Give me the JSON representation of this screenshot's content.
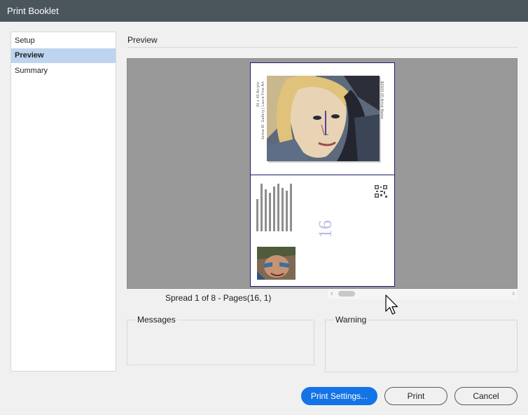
{
  "window": {
    "title": "Print Booklet"
  },
  "sidebar": {
    "items": [
      {
        "label": "Setup",
        "selected": false
      },
      {
        "label": "Preview",
        "selected": true
      },
      {
        "label": "Summary",
        "selected": false
      }
    ]
  },
  "main": {
    "section_title": "Preview",
    "preview": {
      "page_number": "16",
      "caption_left_line1": "30 x 40 Acrylic",
      "caption_left_line2": "Jenna M. Gallery | Laura Fine Art",
      "caption_right": "$1500.00   Artist Name"
    },
    "spread_caption": "Spread 1 of 8 - Pages(16, 1)",
    "messages_label": "Messages",
    "warning_label": "Warning"
  },
  "buttons": {
    "print_settings": "Print Settings...",
    "print": "Print",
    "cancel": "Cancel"
  },
  "colors": {
    "titlebar": "#4a555c",
    "accent": "#1473e6",
    "selection": "#bcd4ee",
    "preview_bg": "#999999"
  }
}
